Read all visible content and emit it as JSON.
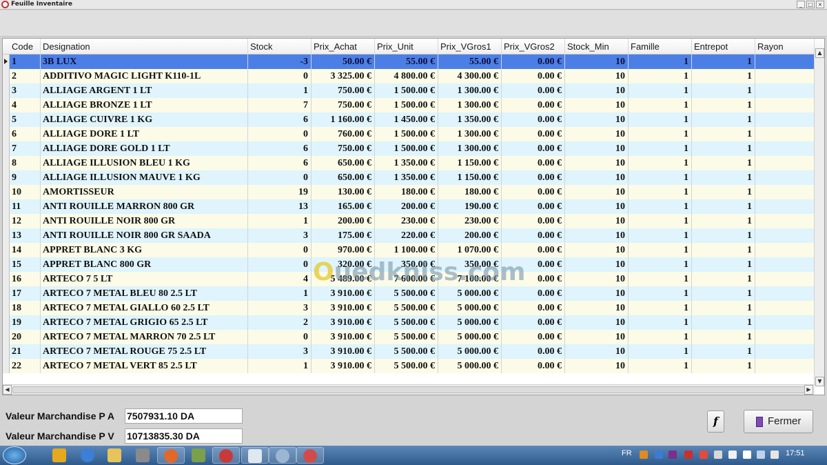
{
  "window": {
    "title": "Feuille Inventaire"
  },
  "columns": [
    "Code",
    "Designation",
    "Stock",
    "Prix_Achat",
    "Prix_Unit",
    "Prix_VGros1",
    "Prix_VGros2",
    "Stock_Min",
    "Famille",
    "Entrepot",
    "Rayon"
  ],
  "rows": [
    [
      "1",
      "3B LUX",
      "-3",
      "50.00 €",
      "55.00 €",
      "55.00 €",
      "0.00 €",
      "10",
      "1",
      "1",
      ""
    ],
    [
      "2",
      "ADDITIVO MAGIC LIGHT K110-1L",
      "0",
      "3 325.00 €",
      "4 800.00 €",
      "4 300.00 €",
      "0.00 €",
      "10",
      "1",
      "1",
      ""
    ],
    [
      "3",
      "ALLIAGE ARGENT 1 LT",
      "1",
      "750.00 €",
      "1 500.00 €",
      "1 300.00 €",
      "0.00 €",
      "10",
      "1",
      "1",
      ""
    ],
    [
      "4",
      "ALLIAGE BRONZE 1 LT",
      "7",
      "750.00 €",
      "1 500.00 €",
      "1 300.00 €",
      "0.00 €",
      "10",
      "1",
      "1",
      ""
    ],
    [
      "5",
      "ALLIAGE CUIVRE 1 KG",
      "6",
      "1 160.00 €",
      "1 450.00 €",
      "1 350.00 €",
      "0.00 €",
      "10",
      "1",
      "1",
      ""
    ],
    [
      "6",
      "ALLIAGE DORE 1 LT",
      "0",
      "760.00 €",
      "1 500.00 €",
      "1 300.00 €",
      "0.00 €",
      "10",
      "1",
      "1",
      ""
    ],
    [
      "7",
      "ALLIAGE DORE GOLD 1 LT",
      "6",
      "750.00 €",
      "1 500.00 €",
      "1 300.00 €",
      "0.00 €",
      "10",
      "1",
      "1",
      ""
    ],
    [
      "8",
      "ALLIAGE ILLUSION BLEU 1 KG",
      "6",
      "650.00 €",
      "1 350.00 €",
      "1 150.00 €",
      "0.00 €",
      "10",
      "1",
      "1",
      ""
    ],
    [
      "9",
      "ALLIAGE ILLUSION MAUVE 1 KG",
      "0",
      "650.00 €",
      "1 350.00 €",
      "1 150.00 €",
      "0.00 €",
      "10",
      "1",
      "1",
      ""
    ],
    [
      "10",
      "AMORTISSEUR",
      "19",
      "130.00 €",
      "180.00 €",
      "180.00 €",
      "0.00 €",
      "10",
      "1",
      "1",
      ""
    ],
    [
      "11",
      "ANTI ROUILLE MARRON 800 GR",
      "13",
      "165.00 €",
      "200.00 €",
      "190.00 €",
      "0.00 €",
      "10",
      "1",
      "1",
      ""
    ],
    [
      "12",
      "ANTI ROUILLE NOIR 800 GR",
      "1",
      "200.00 €",
      "230.00 €",
      "230.00 €",
      "0.00 €",
      "10",
      "1",
      "1",
      ""
    ],
    [
      "13",
      "ANTI ROUILLE NOIR 800 GR SAADA",
      "3",
      "175.00 €",
      "220.00 €",
      "200.00 €",
      "0.00 €",
      "10",
      "1",
      "1",
      ""
    ],
    [
      "14",
      "APPRET BLANC 3 KG",
      "0",
      "970.00 €",
      "1 100.00 €",
      "1 070.00 €",
      "0.00 €",
      "10",
      "1",
      "1",
      ""
    ],
    [
      "15",
      "APPRET BLANC 800 GR",
      "0",
      "320.00 €",
      "350.00 €",
      "350.00 €",
      "0.00 €",
      "10",
      "1",
      "1",
      ""
    ],
    [
      "16",
      "ARTECO 7 5 LT",
      "4",
      "5 489.00 €",
      "7 600.00 €",
      "7 100.00 €",
      "0.00 €",
      "10",
      "1",
      "1",
      ""
    ],
    [
      "17",
      "ARTECO 7 METAL BLEU 80 2.5 LT",
      "1",
      "3 910.00 €",
      "5 500.00 €",
      "5 000.00 €",
      "0.00 €",
      "10",
      "1",
      "1",
      ""
    ],
    [
      "18",
      "ARTECO 7 METAL GIALLO 60 2.5 LT",
      "3",
      "3 910.00 €",
      "5 500.00 €",
      "5 000.00 €",
      "0.00 €",
      "10",
      "1",
      "1",
      ""
    ],
    [
      "19",
      "ARTECO 7 METAL GRIGIO 65 2.5 LT",
      "2",
      "3 910.00 €",
      "5 500.00 €",
      "5 000.00 €",
      "0.00 €",
      "10",
      "1",
      "1",
      ""
    ],
    [
      "20",
      "ARTECO 7 METAL MARRON 70 2.5 LT",
      "0",
      "3 910.00 €",
      "5 500.00 €",
      "5 000.00 €",
      "0.00 €",
      "10",
      "1",
      "1",
      ""
    ],
    [
      "21",
      "ARTECO 7 METAL ROUGE 75 2.5 LT",
      "3",
      "3 910.00 €",
      "5 500.00 €",
      "5 000.00 €",
      "0.00 €",
      "10",
      "1",
      "1",
      ""
    ],
    [
      "22",
      "ARTECO 7 METAL VERT 85 2.5 LT",
      "1",
      "3 910.00 €",
      "5 500.00 €",
      "5 000.00 €",
      "0.00 €",
      "10",
      "1",
      "1",
      ""
    ]
  ],
  "selected_row": 0,
  "watermark": {
    "prefix": "O",
    "rest": "uedkniss.com"
  },
  "totals": {
    "pa_label": "Valeur Marchandise P A",
    "pa_value": "7507931.10 DA",
    "pv_label": "Valeur Marchandise P V",
    "pv_value": "10713835.30 DA"
  },
  "buttons": {
    "f_label": "f",
    "close_label": "Fermer"
  },
  "taskbar": {
    "lang": "FR",
    "clock": "17:51"
  },
  "colors": {
    "row_alt": "#dff4fc",
    "row_norm": "#fbfbe8",
    "row_selected": "#4c7fe6",
    "taskbar": "#3a6799"
  }
}
